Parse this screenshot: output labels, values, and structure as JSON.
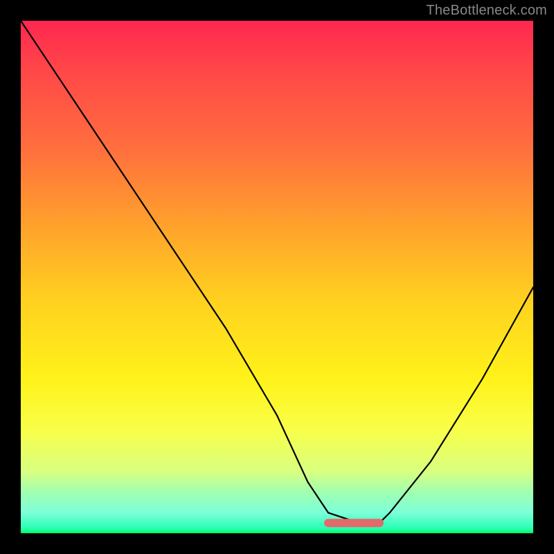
{
  "watermark": "TheBottleneck.com",
  "chart_data": {
    "type": "line",
    "title": "",
    "xlabel": "",
    "ylabel": "",
    "xlim": [
      0,
      100
    ],
    "ylim": [
      0,
      100
    ],
    "grid": false,
    "series": [
      {
        "name": "curve",
        "x": [
          0,
          10,
          20,
          30,
          40,
          50,
          56,
          60,
          66,
          70,
          72,
          80,
          90,
          100
        ],
        "values": [
          100,
          85,
          70,
          55,
          40,
          23,
          10,
          4,
          2,
          2,
          4,
          14,
          30,
          48
        ]
      }
    ],
    "highlight": {
      "name": "min-segment",
      "x_start": 60,
      "x_end": 70,
      "y": 2
    },
    "background_gradient": {
      "top": "#ff2750",
      "bottom": "#00ff66"
    }
  }
}
